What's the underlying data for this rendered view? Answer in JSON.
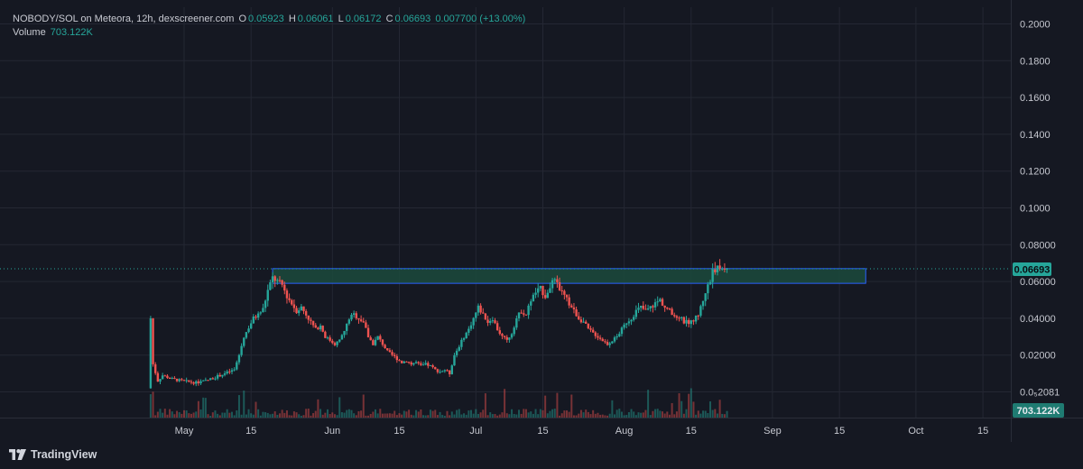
{
  "header": {
    "symbol_line": "NOBODY/SOL on Meteora, 12h, dexscreener.com",
    "ohlc": [
      {
        "key": "O",
        "value": "0.05923"
      },
      {
        "key": "H",
        "value": "0.06061"
      },
      {
        "key": "L",
        "value": "0.06172"
      },
      {
        "key": "C",
        "value": "0.06693"
      }
    ],
    "change": "0.007700 (+13.00%)",
    "volume_label": "Volume",
    "volume_value": "703.122K"
  },
  "watermark": "TradingView",
  "price_badge": "0.06693",
  "volume_badge": "703.122K",
  "colors": {
    "background": "#151822",
    "up": "#26a69a",
    "down": "#ef5350",
    "zone_fill": "#1b4a3c",
    "zone_border": "#2962ff",
    "grid": "#242733"
  },
  "chart_data": {
    "type": "candlestick",
    "title": "NOBODY/SOL on Meteora, 12h, dexscreener.com",
    "ylim": [
      0.0,
      0.205
    ],
    "y_ticks": [
      "0.2000",
      "0.1800",
      "0.1600",
      "0.1400",
      "0.1200",
      "0.1000",
      "0.08000",
      "0.06000",
      "0.04000",
      "0.02000",
      "0.0₅2081"
    ],
    "y_tick_values": [
      0.2,
      0.18,
      0.16,
      0.14,
      0.12,
      0.1,
      0.08,
      0.06,
      0.04,
      0.02,
      0.0
    ],
    "x_ticks": [
      {
        "label": "May",
        "day": 0
      },
      {
        "label": "15",
        "day": 14
      },
      {
        "label": "Jun",
        "day": 31
      },
      {
        "label": "15",
        "day": 45
      },
      {
        "label": "Jul",
        "day": 61
      },
      {
        "label": "15",
        "day": 75
      },
      {
        "label": "Aug",
        "day": 92
      },
      {
        "label": "15",
        "day": 106
      },
      {
        "label": "Sep",
        "day": 123
      },
      {
        "label": "15",
        "day": 137
      },
      {
        "label": "Oct",
        "day": 153
      },
      {
        "label": "15",
        "day": 167
      }
    ],
    "start_day": -7,
    "end_day": 113.5,
    "path": [
      [
        -7,
        0.002
      ],
      [
        -6.5,
        0.04
      ],
      [
        -6,
        0.015
      ],
      [
        -5,
        0.006
      ],
      [
        -4,
        0.009
      ],
      [
        -2,
        0.007
      ],
      [
        0,
        0.006
      ],
      [
        3,
        0.005
      ],
      [
        5,
        0.006
      ],
      [
        7,
        0.008
      ],
      [
        9,
        0.01
      ],
      [
        11,
        0.012
      ],
      [
        12,
        0.02
      ],
      [
        13,
        0.03
      ],
      [
        14,
        0.035
      ],
      [
        15,
        0.04
      ],
      [
        16,
        0.042
      ],
      [
        17,
        0.045
      ],
      [
        18,
        0.055
      ],
      [
        19,
        0.062
      ],
      [
        20,
        0.06
      ],
      [
        21,
        0.058
      ],
      [
        22,
        0.052
      ],
      [
        23,
        0.048
      ],
      [
        24,
        0.044
      ],
      [
        25,
        0.046
      ],
      [
        26,
        0.042
      ],
      [
        27,
        0.038
      ],
      [
        28,
        0.034
      ],
      [
        29,
        0.036
      ],
      [
        30,
        0.03
      ],
      [
        31,
        0.028
      ],
      [
        32,
        0.026
      ],
      [
        33,
        0.028
      ],
      [
        34,
        0.033
      ],
      [
        35,
        0.04
      ],
      [
        36,
        0.042
      ],
      [
        37,
        0.04
      ],
      [
        38,
        0.038
      ],
      [
        39,
        0.03
      ],
      [
        40,
        0.026
      ],
      [
        41,
        0.03
      ],
      [
        42,
        0.026
      ],
      [
        43,
        0.022
      ],
      [
        44,
        0.02
      ],
      [
        45,
        0.018
      ],
      [
        46,
        0.016
      ],
      [
        47,
        0.017
      ],
      [
        48,
        0.015
      ],
      [
        49,
        0.016
      ],
      [
        50,
        0.014
      ],
      [
        51,
        0.015
      ],
      [
        52,
        0.014
      ],
      [
        53,
        0.012
      ],
      [
        54,
        0.011
      ],
      [
        55,
        0.012
      ],
      [
        56,
        0.01
      ],
      [
        57,
        0.02
      ],
      [
        58,
        0.025
      ],
      [
        59,
        0.03
      ],
      [
        60,
        0.034
      ],
      [
        61,
        0.04
      ],
      [
        62,
        0.046
      ],
      [
        63,
        0.042
      ],
      [
        64,
        0.038
      ],
      [
        65,
        0.04
      ],
      [
        66,
        0.034
      ],
      [
        67,
        0.03
      ],
      [
        68,
        0.028
      ],
      [
        69,
        0.032
      ],
      [
        70,
        0.04
      ],
      [
        71,
        0.044
      ],
      [
        72,
        0.042
      ],
      [
        73,
        0.05
      ],
      [
        74,
        0.054
      ],
      [
        75,
        0.056
      ],
      [
        76,
        0.052
      ],
      [
        77,
        0.058
      ],
      [
        78,
        0.06
      ],
      [
        79,
        0.056
      ],
      [
        80,
        0.052
      ],
      [
        81,
        0.048
      ],
      [
        82,
        0.044
      ],
      [
        83,
        0.04
      ],
      [
        84,
        0.038
      ],
      [
        85,
        0.034
      ],
      [
        86,
        0.032
      ],
      [
        87,
        0.03
      ],
      [
        88,
        0.028
      ],
      [
        89,
        0.026
      ],
      [
        90,
        0.028
      ],
      [
        91,
        0.03
      ],
      [
        92,
        0.034
      ],
      [
        93,
        0.038
      ],
      [
        94,
        0.04
      ],
      [
        95,
        0.044
      ],
      [
        96,
        0.046
      ],
      [
        97,
        0.044
      ],
      [
        98,
        0.046
      ],
      [
        99,
        0.048
      ],
      [
        100,
        0.05
      ],
      [
        101,
        0.046
      ],
      [
        102,
        0.044
      ],
      [
        103,
        0.04
      ],
      [
        104,
        0.041
      ],
      [
        105,
        0.038
      ],
      [
        106,
        0.038
      ],
      [
        107,
        0.039
      ],
      [
        108,
        0.042
      ],
      [
        109,
        0.05
      ],
      [
        109.8,
        0.057
      ],
      [
        110.5,
        0.06
      ],
      [
        111,
        0.06693
      ]
    ],
    "zone": {
      "x0_day": 18.5,
      "x1_day": 142.5,
      "y0": 0.059,
      "y1": 0.067
    },
    "last_price": 0.06693
  }
}
